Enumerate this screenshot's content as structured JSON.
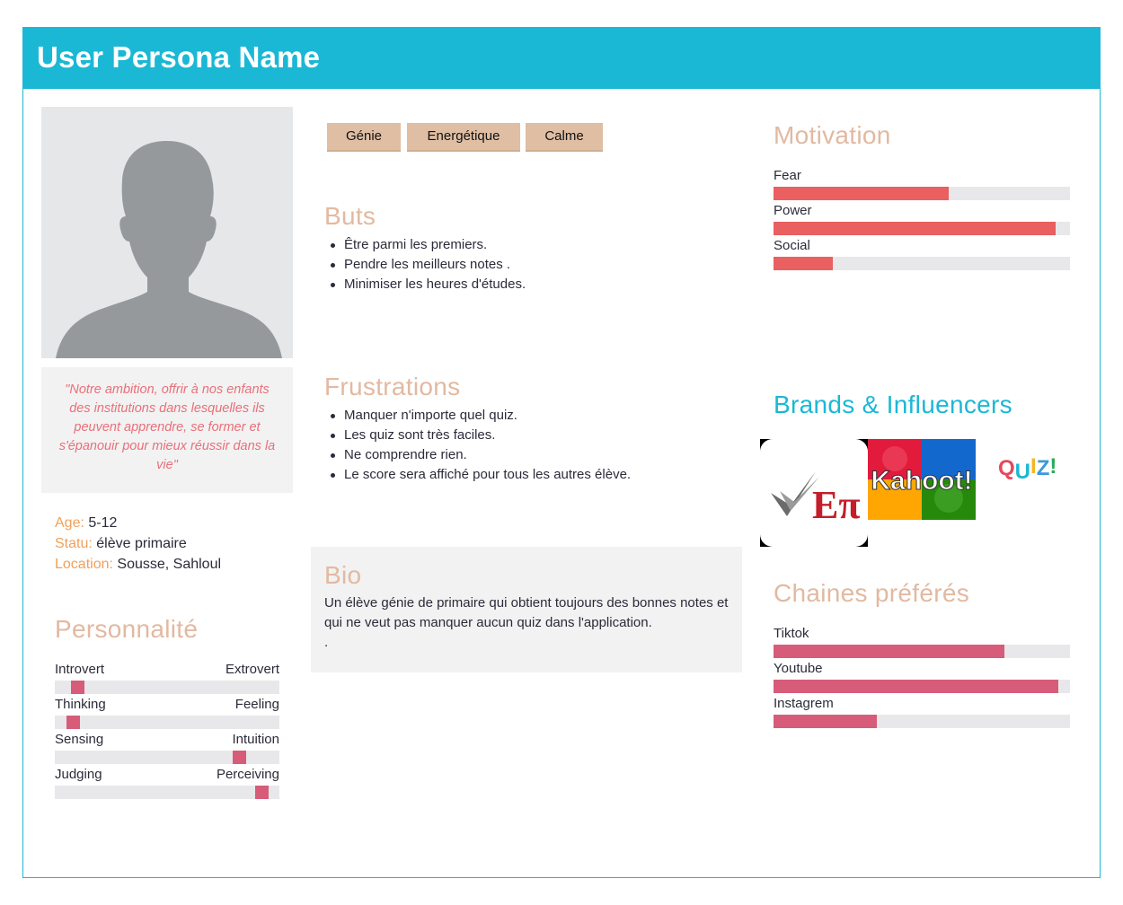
{
  "header": {
    "title": "User Persona Name"
  },
  "quote": "\"Notre ambition, offrir à nos enfants des institutions dans lesquelles ils peuvent apprendre, se former et s'épanouir pour mieux réussir dans la vie\"",
  "info": {
    "age_label": "Age:",
    "age_value": "5-12",
    "status_label": "Statu:",
    "status_value": "élève primaire",
    "location_label": "Location:",
    "location_value": "Sousse, Sahloul"
  },
  "personality": {
    "title": "Personnalité",
    "rows": [
      {
        "left": "Introvert",
        "right": "Extrovert",
        "value": 0.1
      },
      {
        "left": "Thinking",
        "right": "Feeling",
        "value": 0.08
      },
      {
        "left": "Sensing",
        "right": "Intuition",
        "value": 0.82
      },
      {
        "left": "Judging",
        "right": "Perceiving",
        "value": 0.92
      }
    ]
  },
  "tags": [
    "Génie",
    "Energétique",
    "Calme"
  ],
  "goals": {
    "title": "Buts",
    "items": [
      "Être parmi les premiers.",
      "Pendre les meilleurs notes .",
      "Minimiser les heures d'études."
    ]
  },
  "frustrations": {
    "title": "Frustrations",
    "items": [
      "Manquer n'importe quel quiz.",
      "Les quiz sont très faciles.",
      "Ne comprendre rien.",
      "Le score sera affiché pour tous les autres élève."
    ]
  },
  "bio": {
    "title": "Bio",
    "text": "Un élève génie de primaire qui obtient toujours des bonnes notes et qui ne veut pas manquer aucun quiz dans l'application.",
    "extra": "."
  },
  "motivation": {
    "title": "Motivation",
    "color": "#ea5f5f",
    "items": [
      {
        "label": "Fear",
        "value": 0.59
      },
      {
        "label": "Power",
        "value": 0.95
      },
      {
        "label": "Social",
        "value": 0.2
      }
    ]
  },
  "brands": {
    "title": "Brands & Influencers",
    "logos": [
      {
        "name": "epi-logo",
        "text": "Eπ"
      },
      {
        "name": "kahoot-logo",
        "text": "Kahoot!"
      },
      {
        "name": "quiz-logo",
        "text": "QUIZ!"
      }
    ]
  },
  "channels": {
    "title": "Chaines préférés",
    "color": "#d75c79",
    "items": [
      {
        "label": "Tiktok",
        "value": 0.78
      },
      {
        "label": "Youtube",
        "value": 0.96
      },
      {
        "label": "Instagrem",
        "value": 0.35
      }
    ]
  }
}
